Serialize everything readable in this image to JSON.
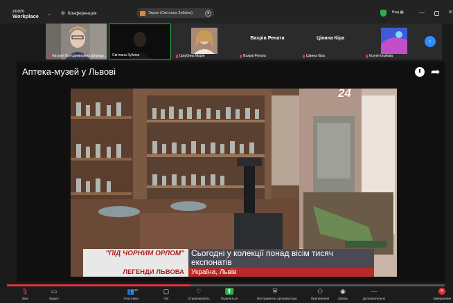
{
  "app": {
    "logo_line1": "zoom",
    "logo_line2": "Workplace"
  },
  "topbar": {
    "meeting_label": "Конференция",
    "share_label": "Экран (Світлана Зуйкіна)",
    "view_label": "Вид",
    "shield_color": "#2fae4a"
  },
  "participants": [
    {
      "name": "Наталія Володимирівна Шереду...",
      "video": true
    },
    {
      "name": "Світлана Зуйкіна",
      "video": true,
      "active": true
    },
    {
      "name": "Щербина Марія",
      "video": true
    },
    {
      "big_name": "Вахрів Рената",
      "name": "Вахрів Рената",
      "video": false
    },
    {
      "big_name": "Цівина Кіра",
      "name": "Цівина Кіра",
      "video": false
    },
    {
      "name": "Ксенія Ільйова",
      "video": true
    }
  ],
  "share": {
    "title": "Аптека-музей у Львові",
    "channel_logo": "24",
    "caption_left_1": "\"ПІД ЧОРНИМ ОРЛОМ\"",
    "caption_right_1": "Сьогодні у колекції понад вісім тисяч експонатів",
    "caption_left_2": "ЛЕГЕНДИ ЛЬВОВА",
    "caption_right_2": "Україна, Львів",
    "progress": 0.42
  },
  "toolbar": [
    {
      "id": "audio",
      "label": "Звук",
      "icon": "mic-muted-icon",
      "glyph": "🎙"
    },
    {
      "id": "video",
      "label": "Видео",
      "icon": "camera-icon",
      "glyph": "▭"
    },
    {
      "id": "participants",
      "label": "Участники",
      "icon": "participants-icon",
      "glyph": "👥",
      "badge": "10"
    },
    {
      "id": "chat",
      "label": "Чат",
      "icon": "chat-icon",
      "glyph": "▢"
    },
    {
      "id": "react",
      "label": "Отреагировать",
      "icon": "heart-icon",
      "glyph": "♡"
    },
    {
      "id": "share",
      "label": "Поделиться",
      "icon": "share-screen-icon",
      "glyph": "⬆"
    },
    {
      "id": "host",
      "label": "Инструменты организатора",
      "icon": "shield-icon",
      "glyph": "⛨"
    },
    {
      "id": "apps",
      "label": "Приложения",
      "icon": "apps-icon",
      "glyph": "⚇"
    },
    {
      "id": "record",
      "label": "Запись",
      "icon": "record-icon",
      "glyph": "◉"
    },
    {
      "id": "more",
      "label": "Дополнительно",
      "icon": "more-icon",
      "glyph": "⋯"
    },
    {
      "id": "end",
      "label": "Завершение",
      "icon": "end-icon",
      "glyph": "✕"
    }
  ]
}
